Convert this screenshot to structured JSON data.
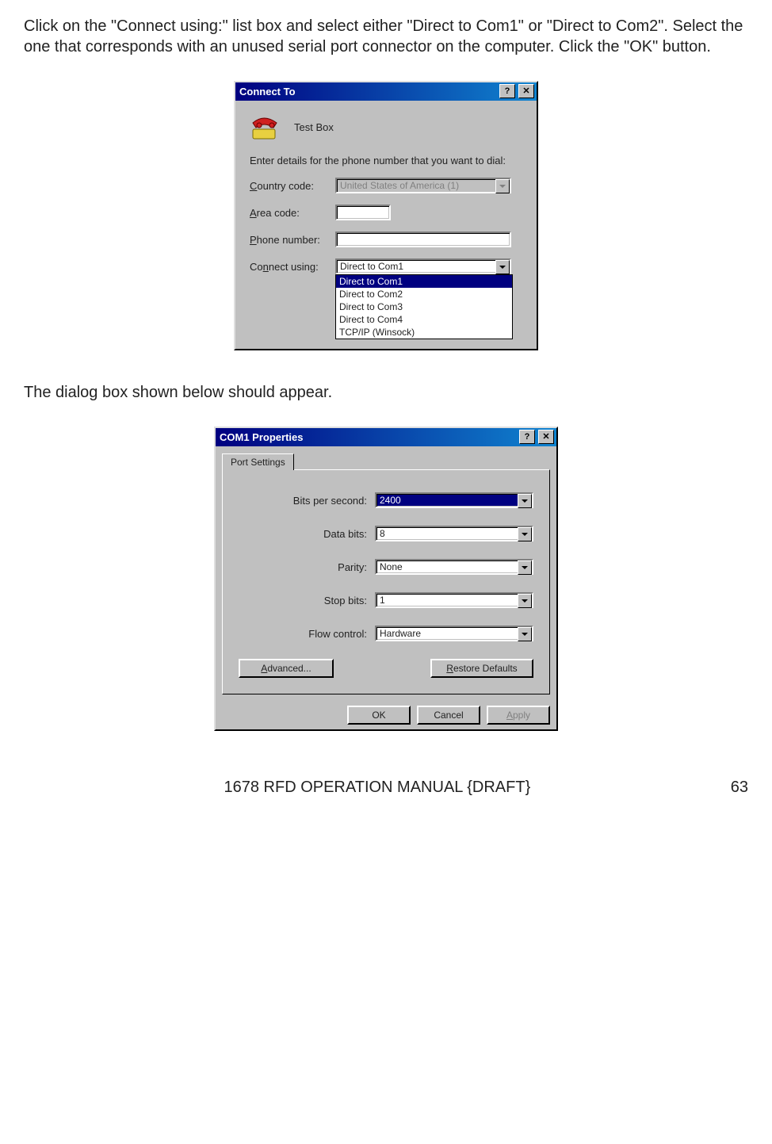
{
  "paragraph1": "Click on the \"Connect using:\" list box and select either \"Direct to Com1\" or \"Direct to Com2\".  Select the one that corresponds with an unused serial port connector on the computer.  Click the \"OK\" button.",
  "paragraph2": "The dialog box shown below should appear.",
  "connect": {
    "title": "Connect To",
    "icon_name": "Test Box",
    "instruction": "Enter details for the phone number that you want to dial:",
    "labels": {
      "country": "Country code:",
      "area": "Area code:",
      "phone": "Phone number:",
      "using": "Connect using:"
    },
    "values": {
      "country": "United States of America (1)",
      "area": "",
      "phone": "",
      "using": "Direct to Com1"
    },
    "options": [
      "Direct to Com1",
      "Direct to Com2",
      "Direct to Com3",
      "Direct to Com4",
      "TCP/IP (Winsock)"
    ]
  },
  "com": {
    "title": "COM1 Properties",
    "tab": "Port Settings",
    "labels": {
      "bps": "Bits per second:",
      "data": "Data bits:",
      "parity": "Parity:",
      "stop": "Stop bits:",
      "flow": "Flow control:"
    },
    "values": {
      "bps": "2400",
      "data": "8",
      "parity": "None",
      "stop": "1",
      "flow": "Hardware"
    },
    "buttons": {
      "advanced": "Advanced...",
      "restore": "Restore Defaults",
      "ok": "OK",
      "cancel": "Cancel",
      "apply": "Apply"
    }
  },
  "footer": {
    "left": "1678 RFD OPERATION MANUAL {DRAFT}",
    "right": "63"
  },
  "glyphs": {
    "help": "?",
    "close": "✕"
  }
}
